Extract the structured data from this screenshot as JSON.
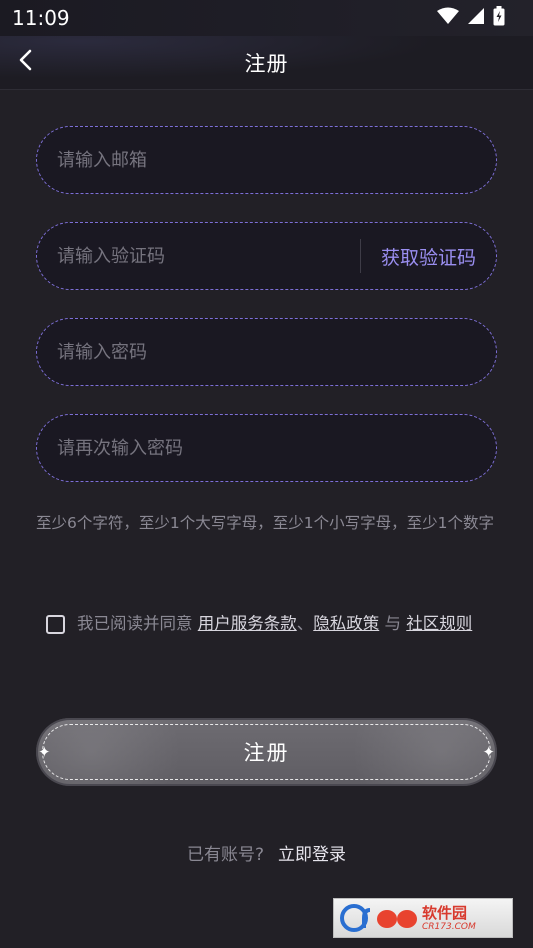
{
  "status_bar": {
    "time": "11:09",
    "icons": [
      "wifi-icon",
      "signal-icon",
      "battery-icon"
    ]
  },
  "header": {
    "title": "注册",
    "back_icon": "chevron-left-icon"
  },
  "form": {
    "email": {
      "value": "",
      "placeholder": "请输入邮箱"
    },
    "code": {
      "value": "",
      "placeholder": "请输入验证码",
      "button_label": "获取验证码"
    },
    "password": {
      "value": "",
      "placeholder": "请输入密码"
    },
    "confirm_password": {
      "value": "",
      "placeholder": "请再次输入密码"
    },
    "hint": "至少6个字符，至少1个大写字母，至少1个小写字母，至少1个数字"
  },
  "agreement": {
    "checked": false,
    "prefix": "我已阅读并同意 ",
    "terms_link": "用户服务条款",
    "sep1": "、",
    "privacy_link": "隐私政策",
    "sep2": " 与 ",
    "community_link": "社区规则"
  },
  "register_button": {
    "label": "注册"
  },
  "login_prompt": {
    "text": "已有账号?",
    "link": "立即登录"
  },
  "watermark": {
    "brand": "软件园",
    "domain": "CR173.COM"
  },
  "colors": {
    "background": "#222026",
    "field_border": "#7d6fd6",
    "accent_link": "#9a8ef0",
    "button": "#6e6c72"
  }
}
